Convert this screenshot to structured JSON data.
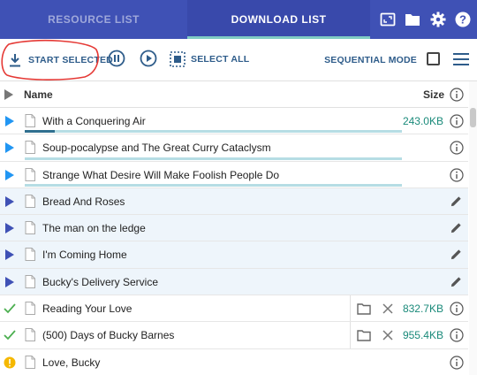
{
  "tabs": [
    {
      "label": "RESOURCE LIST"
    },
    {
      "label": "DOWNLOAD LIST"
    }
  ],
  "nav_icons": [
    "window-icon",
    "folder-icon",
    "gear-icon",
    "help-icon"
  ],
  "toolbar": {
    "start_selected": "START SELECTED",
    "select_all": "SELECT ALL",
    "sequential_mode": "SEQUENTIAL MODE"
  },
  "list": {
    "name_header": "Name",
    "size_header": "Size",
    "items": [
      {
        "title": "With a Conquering Air",
        "size": "243.0KB",
        "state": "downloading",
        "progress": 0.08
      },
      {
        "title": "Soup-pocalypse and The Great Curry Cataclysm",
        "size": "",
        "state": "downloading",
        "progress": 0
      },
      {
        "title": "Strange What Desire Will Make Foolish People Do",
        "size": "",
        "state": "downloading",
        "progress": 0
      },
      {
        "title": "Bread And Roses",
        "size": "",
        "state": "queued"
      },
      {
        "title": "The man on the ledge",
        "size": "",
        "state": "queued"
      },
      {
        "title": "I'm Coming Home",
        "size": "",
        "state": "queued"
      },
      {
        "title": "Bucky's Delivery Service",
        "size": "",
        "state": "queued"
      },
      {
        "title": "Reading Your Love",
        "size": "832.7KB",
        "state": "done"
      },
      {
        "title": "(500) Days of Bucky Barnes",
        "size": "955.4KB",
        "state": "done"
      },
      {
        "title": "Love, Bucky",
        "size": "",
        "state": "warning"
      }
    ]
  },
  "colors": {
    "nav_bg": "#3f51b5",
    "accent": "#2e5c8a",
    "size_text": "#1a8a7a",
    "done_green": "#4caf50",
    "warning": "#f5b800",
    "annotation_red": "#e53935"
  }
}
